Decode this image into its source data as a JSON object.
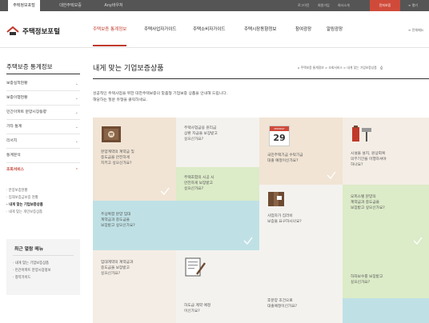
{
  "topbar": {
    "tabs": [
      "주택정보포털",
      "대한주택보증",
      "Any바우처"
    ],
    "utils": [
      "로그아웃",
      "회원가입",
      "회사소개"
    ],
    "cert_button": "전자보증",
    "menu": "열기"
  },
  "header": {
    "logo": "주택정보포털",
    "nav": [
      "주택보증 통계정보",
      "주택사업자가이드",
      "주택소비자가이드",
      "주택시장동향정보",
      "참여광장",
      "알림광장"
    ],
    "sitemap": "전체메뉴"
  },
  "sidebar": {
    "title": "주택보증 통계정보",
    "items": [
      "보증실적현황",
      "보증이행현황",
      "민간아파트 분양시장동향",
      "기타 통계",
      "리서치",
      "통계분석",
      "조회서비스"
    ],
    "sub_items": [
      "분양보증현황",
      "임대보증금보증 현황",
      "내게 맞는 기업보증상품",
      "내게 맞는 개인보증상품"
    ],
    "recent_title": "최근 열람 메뉴",
    "recent_links": [
      "내게 맞는 기업보증상품",
      "민간아파트 분양시장정보",
      "청약가이드"
    ]
  },
  "content": {
    "title": "내게 맞는 기업보증상품",
    "breadcrumb": "주택보증 통계정보 > 조회서비스 > 내게 맞는 기업보증상품",
    "intro_line1": "성공적인 주택사업을 위한 대한주택보증의 맞춤형 기업보증 상품을 안내해 드립니다.",
    "intro_line2": "해당하는 질문 유형을 클릭하세요.",
    "calendar_month": "MONDAY",
    "calendar_day": "29",
    "cards": [
      "분양계약의 계약금 및\n중도금을 안전하게\n지키고 싶으신가요?",
      "주택사업금융 원리금\n상환 지급을 보장받고\n싶으신가요?",
      "국민주택기금 수탁기금\n대출 예정이신가요?",
      "시설을 설치, 원상회복\n의무기간을 이행하셔야\n하나요?",
      "주택조합의 시공 시\n안전하게 보장받고\n싶으신가요?",
      "주상복합 분양 임대\n계약금과 중도금을\n보장받고 싶으신가요?",
      "사업자가 집러비\n보증을 요구하시나요?",
      "오피스텔 분양의\n계약금과 중도금을\n보장받고 싶으신가요?",
      "임대계약의 계약금과\n중도금을 보장받고\n싶으신가요?",
      "하도급 계약 예정\n이신가요?",
      "후분양 조건으로\n대출예정이신가요?",
      "하자보수를 보장받고\n싶으신가요?"
    ]
  }
}
